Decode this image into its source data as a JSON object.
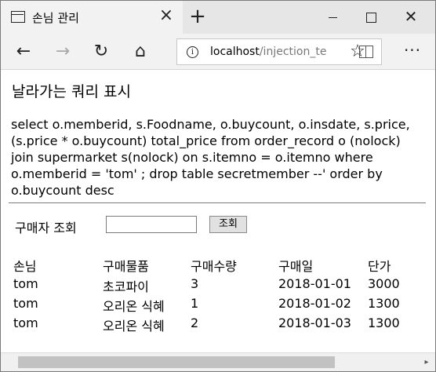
{
  "browser": {
    "tab_title": "손님 관리",
    "tab_close": "×",
    "new_tab": "+",
    "window_close": "✕",
    "url_host": "localhost",
    "url_path": "/injection_te",
    "info_glyph": "i",
    "back_glyph": "←",
    "forward_glyph": "→",
    "refresh_glyph": "↻",
    "home_glyph": "⌂",
    "star_glyph": "☆",
    "more_glyph": "···"
  },
  "page": {
    "heading": "날라가는 쿼리 표시",
    "query": "select o.memberid, s.Foodname, o.buycount, o.insdate, s.price, (s.price * o.buycount) total_price from order_record o (nolock) join supermarket s(nolock) on s.itemno = o.itemno where o.memberid = 'tom' ; drop table secretmember --' order by o.buycount desc",
    "search": {
      "label": "구매자 조회",
      "input_value": "",
      "button_label": "조회"
    },
    "table": {
      "headers": [
        "손님",
        "구매물품",
        "구매수량",
        "구매일",
        "단가"
      ],
      "rows": [
        [
          "tom",
          "초코파이",
          "3",
          "2018-01-01",
          "3000"
        ],
        [
          "tom",
          "오리온 식혜",
          "1",
          "2018-01-02",
          "1300"
        ],
        [
          "tom",
          "오리온 식혜",
          "2",
          "2018-01-03",
          "1300"
        ]
      ]
    }
  },
  "scrollbar": {
    "right_arrow": "▸"
  }
}
